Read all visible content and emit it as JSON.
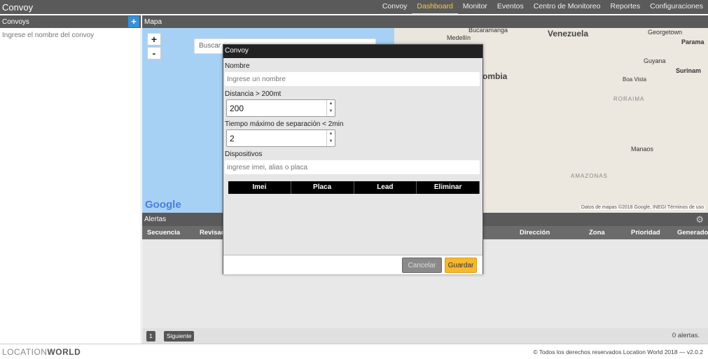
{
  "app": {
    "title": "Convoy"
  },
  "nav": [
    "Convoy",
    "Dashboard",
    "Monitor",
    "Eventos",
    "Centro de Monitoreo",
    "Reportes",
    "Configuraciones"
  ],
  "sidebar": {
    "title": "Convoys",
    "add_icon": "plus-icon",
    "search_placeholder": "Ingrese el nombre del convoy"
  },
  "map": {
    "title": "Mapa",
    "zoom_in": "+",
    "zoom_out": "-",
    "search_placeholder": "Buscar",
    "labels": {
      "venezuela": "Venezuela",
      "colombia": "ombia",
      "bucaramanga": "Bucaramanga",
      "medellin": "Medellín",
      "georgetown": "Georgetown",
      "paramaribo": "Parama",
      "guyana": "Guyana",
      "surinam": "Surinam",
      "boavista": "Boa Vista",
      "roraima": "RORAIMA",
      "manaos": "Manaos",
      "amazonas": "AMAZONAS"
    },
    "google": "Google",
    "attribution": "Datos de mapas ©2018 Google, INEGI    Términos de uso"
  },
  "alerts": {
    "title": "Alertas",
    "columns": [
      "Secuencia",
      "Revisado",
      "Dirección",
      "Zona",
      "Prioridad",
      "Generado"
    ],
    "page_number": "1",
    "next_label": "Siguiente",
    "count_text": "0 alertas."
  },
  "footer": {
    "brand_light": "LOCATION",
    "brand_bold": "WORLD",
    "copyright": "© Todos los derechos reservados Location World 2018 — v2.0.2"
  },
  "modal": {
    "title": "Convoy",
    "name_label": "Nombre",
    "name_placeholder": "Ingrese un nombre",
    "distance_label": "Distancia > 200mt",
    "distance_value": "200",
    "time_label": "Tiempo máximo de separación < 2min",
    "time_value": "2",
    "devices_label": "Dispositivos",
    "devices_placeholder": "ingrese imei, alias o placa",
    "table_headers": [
      "Imei",
      "Placa",
      "Lead",
      "Eliminar"
    ],
    "cancel_label": "Cancelar",
    "save_label": "Guardar"
  }
}
